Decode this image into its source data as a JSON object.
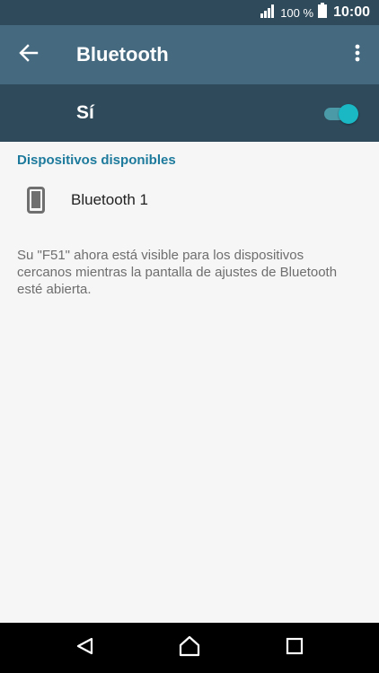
{
  "status_bar": {
    "battery_percent": "100 %",
    "time": "10:00",
    "icons": [
      "signal-icon",
      "battery-icon"
    ]
  },
  "app_bar": {
    "title": "Bluetooth",
    "icons": [
      "back-arrow-icon",
      "more-vert-icon"
    ]
  },
  "master_switch": {
    "label": "Sí",
    "enabled": true,
    "accent_color": "#1ab7c4"
  },
  "available_devices": {
    "header": "Dispositivos disponibles",
    "items": [
      {
        "name": "Bluetooth 1",
        "icon": "phone-icon"
      }
    ]
  },
  "visibility_message": "Su \"F51\" ahora está visible para los dispositivos cercanos mientras la pantalla de ajustes de Bluetooth esté abierta.",
  "nav_bar": {
    "icons": [
      "back-icon",
      "home-icon",
      "recents-icon"
    ]
  }
}
